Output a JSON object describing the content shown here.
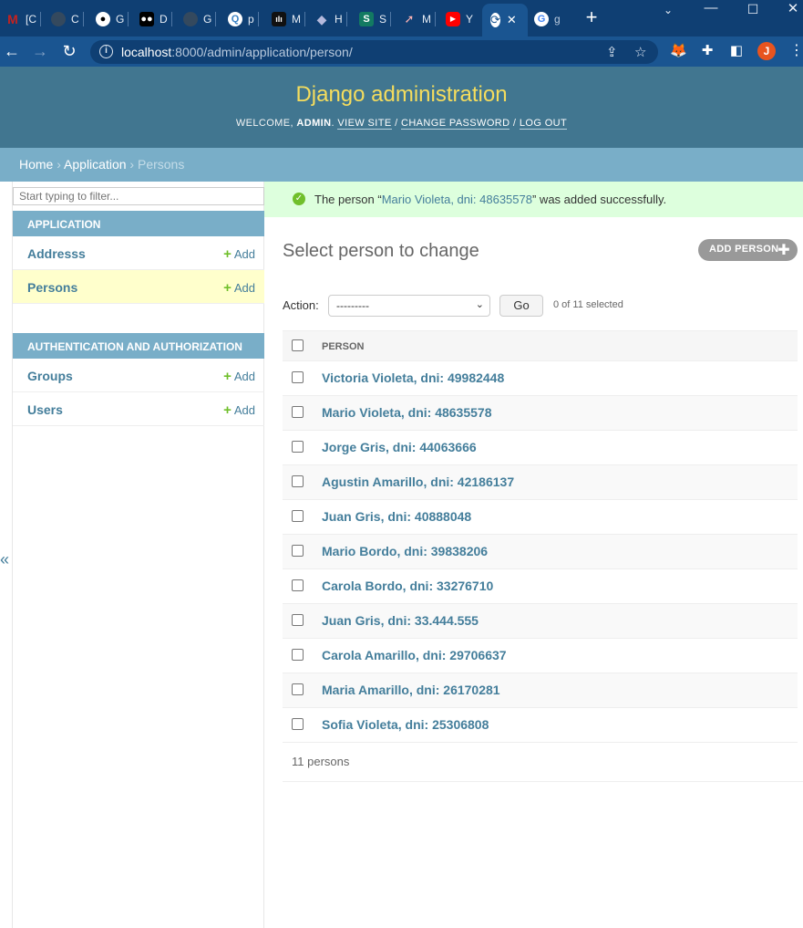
{
  "browser": {
    "tabs": [
      {
        "label": "[C",
        "icon": "gmail-icon",
        "color": "#c5221f"
      },
      {
        "label": "C",
        "icon": "github-icon",
        "color": "#24292f"
      },
      {
        "label": "G",
        "icon": "github-icon",
        "color": "#24292f"
      },
      {
        "label": "D",
        "icon": "medium-icon",
        "color": "#000000"
      },
      {
        "label": "G",
        "icon": "github-icon",
        "color": "#24292f"
      },
      {
        "label": "p",
        "icon": "search-icon",
        "color": "#3b82c4"
      },
      {
        "label": "M",
        "icon": "chart-icon",
        "color": "#111111"
      },
      {
        "label": "H",
        "icon": "ethereum-icon",
        "color": "#6b6f94"
      },
      {
        "label": "S",
        "icon": "s-icon",
        "color": "#137a62"
      },
      {
        "label": "M",
        "icon": "rocket-icon",
        "color": "#3d5a80"
      },
      {
        "label": "Y",
        "icon": "youtube-icon",
        "color": "#ff0000"
      }
    ],
    "active_tab_close": "✕",
    "last_tab_label": "g",
    "new_tab": "+",
    "url_host": "localhost",
    "url_path": ":8000/admin/application/person/",
    "profile_initial": "J"
  },
  "header": {
    "brand": "Django administration",
    "welcome": "Welcome,",
    "user": "admin",
    "view_site": "View site",
    "change_password": "Change password",
    "log_out": "Log out"
  },
  "breadcrumbs": {
    "home": "Home",
    "app": "Application",
    "current": "Persons"
  },
  "sidebar": {
    "filter_placeholder": "Start typing to filter...",
    "modules": [
      {
        "caption": "Application",
        "items": [
          {
            "label": "Addresss",
            "add": "Add"
          },
          {
            "label": "Persons",
            "add": "Add"
          }
        ]
      },
      {
        "caption": "Authentication and Authorization",
        "items": [
          {
            "label": "Groups",
            "add": "Add"
          },
          {
            "label": "Users",
            "add": "Add"
          }
        ]
      }
    ],
    "collapse": "«"
  },
  "message": {
    "prefix": "The person “",
    "link": "Mario Violeta, dni: 48635578",
    "suffix": "” was added successfully."
  },
  "main": {
    "title": "Select person to change",
    "add_button": "Add person",
    "action_label": "Action:",
    "action_value": "---------",
    "go": "Go",
    "selected": "0 of 11 selected",
    "column_header": "Person",
    "rows": [
      "Victoria Violeta, dni: 49982448",
      "Mario Violeta, dni: 48635578",
      "Jorge Gris, dni: 44063666",
      "Agustin Amarillo, dni: 42186137",
      "Juan Gris, dni: 40888048",
      "Mario Bordo, dni: 39838206",
      "Carola Bordo, dni: 33276710",
      "Juan Gris, dni: 33.444.555",
      "Carola Amarillo, dni: 29706637",
      "Maria Amarillo, dni: 26170281",
      "Sofia Violeta, dni: 25306808"
    ],
    "count": "11 persons"
  }
}
